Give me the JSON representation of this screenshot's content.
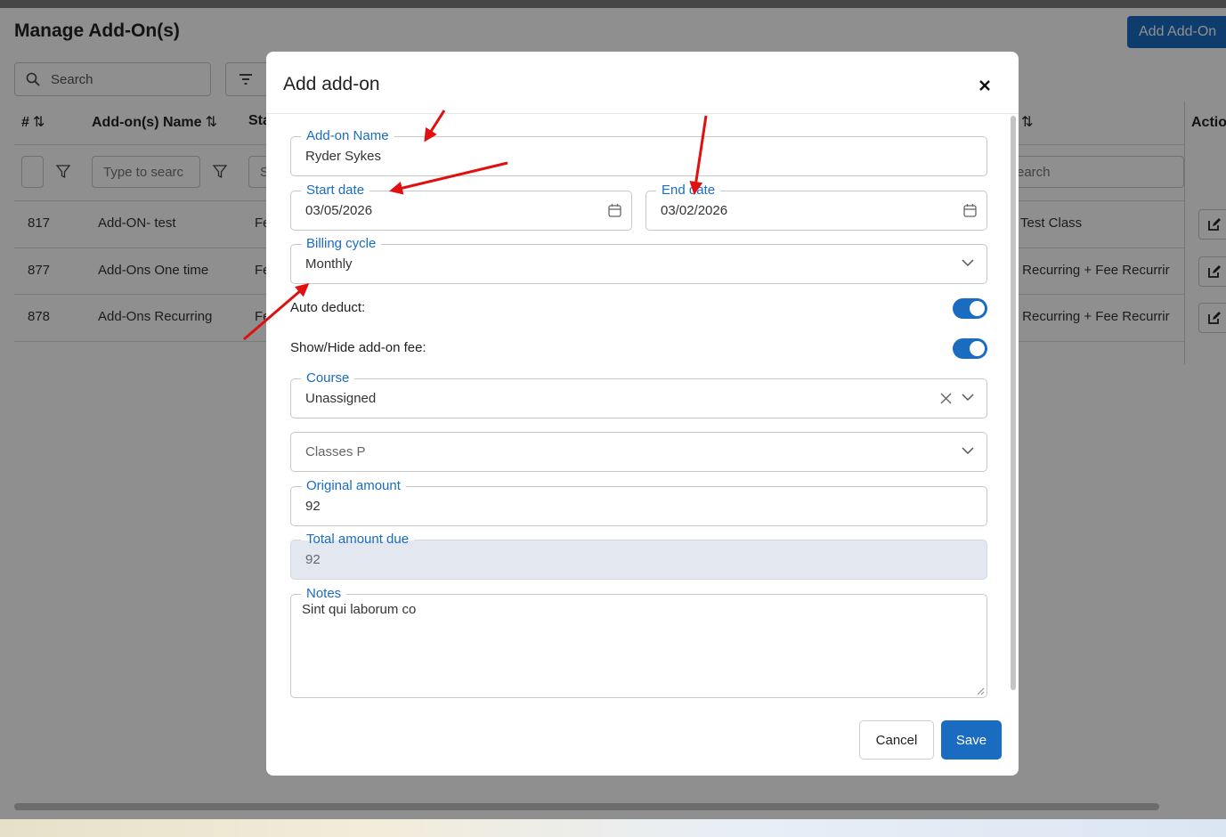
{
  "background": {
    "title": "Manage Add-On(s)",
    "add_button": "Add Add-On",
    "search_placeholder": "Search",
    "columns": {
      "id": "#",
      "name": "Add-on(s) Name",
      "status": "Sta",
      "right": "",
      "actions": "Actio"
    },
    "filters": {
      "name_placeholder": "Type to searc",
      "status_partial": "S",
      "right_partial": "earch"
    },
    "rows": [
      {
        "id": "817",
        "name": "Add-ON- test",
        "status": "Fe",
        "right": "Test Class"
      },
      {
        "id": "877",
        "name": "Add-Ons One time",
        "status": "Fe",
        "right": "- Recurring + Fee Recurrir"
      },
      {
        "id": "878",
        "name": "Add-Ons Recurring",
        "status": "Fe",
        "right": "- Recurring + Fee Recurrir"
      }
    ]
  },
  "modal": {
    "title": "Add add-on",
    "addon_name": {
      "label": "Add-on Name",
      "value": "Ryder Sykes"
    },
    "start_date": {
      "label": "Start date",
      "value": "03/05/2026"
    },
    "end_date": {
      "label": "End date",
      "value": "03/02/2026"
    },
    "billing_cycle": {
      "label": "Billing cycle",
      "value": "Monthly"
    },
    "auto_deduct": {
      "label": "Auto deduct:",
      "enabled": true
    },
    "show_hide_fee": {
      "label": "Show/Hide add-on fee:",
      "enabled": true
    },
    "course": {
      "label": "Course",
      "value": "Unassigned"
    },
    "classes": {
      "placeholder": "Classes P"
    },
    "original_amount": {
      "label": "Original amount",
      "value": "92"
    },
    "total_amount_due": {
      "label": "Total amount due",
      "value": "92"
    },
    "notes": {
      "label": "Notes",
      "value": "Sint qui laborum co"
    },
    "cancel_label": "Cancel",
    "save_label": "Save"
  },
  "colors": {
    "primary": "#1a6cc0",
    "annotation_arrow": "#e01010",
    "overlay": "#8f8f8f"
  }
}
